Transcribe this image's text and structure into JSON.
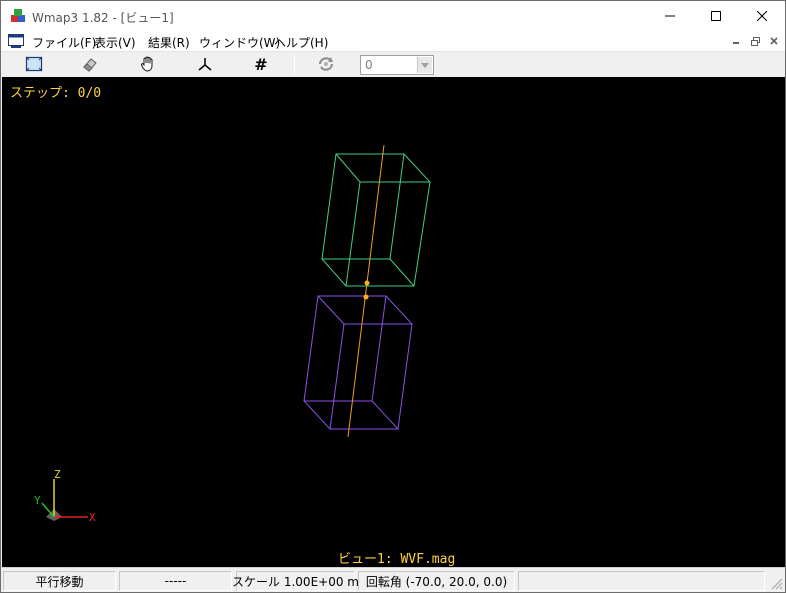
{
  "window": {
    "title": "Wmap3 1.82 - [ビュー1]"
  },
  "menu": {
    "file": "ファイル(F)",
    "view": "表示(V)",
    "result": "結果(R)",
    "window": "ウィンドウ(W)",
    "help": "ヘルプ(H)"
  },
  "toolbar": {
    "step_value": "0",
    "icons": [
      "fit-view-icon",
      "eraser-icon",
      "pan-hand-icon",
      "axes-icon",
      "grid-hash-icon",
      "rotate-icon"
    ],
    "grid_symbol": "#"
  },
  "viewport": {
    "step_label": "ステップ: 0/0",
    "caption": "ビュー1: WVF.mag",
    "axes": {
      "x": "X",
      "y": "Y",
      "z": "Z"
    },
    "colors": {
      "background": "#000000",
      "text": "#ffd23f",
      "upper_box": "#3fcf7f",
      "lower_box": "#8a4fe8",
      "center_line": "#f0a020",
      "axis_x": "#e02020",
      "axis_y": "#20c020",
      "axis_z": "#e0d020"
    }
  },
  "status": {
    "mode": "平行移動",
    "info": "-----",
    "scale": "スケール 1.00E+00 m",
    "rotation": "回転角 (-70.0, 20.0, 0.0)"
  }
}
